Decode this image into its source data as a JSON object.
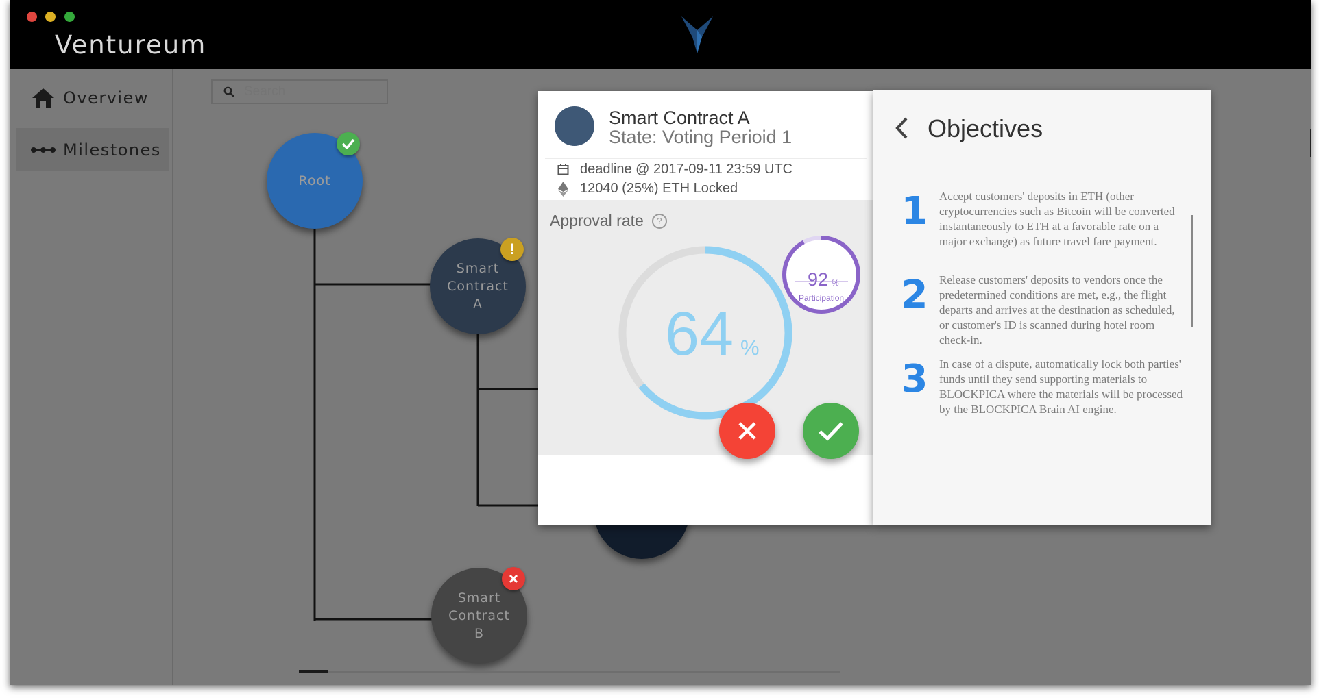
{
  "app": {
    "title": "Ventureum"
  },
  "sidebar": {
    "items": [
      {
        "label": "Overview",
        "icon": "home-icon"
      },
      {
        "label": "Milestones",
        "icon": "milestones-icon"
      }
    ]
  },
  "search": {
    "placeholder": "Search"
  },
  "tree": {
    "nodes": [
      {
        "label": "Root",
        "status": "approved"
      },
      {
        "label": "Smart Contract A",
        "status": "warning"
      },
      {
        "label": "Smart Contract B",
        "status": "rejected"
      }
    ]
  },
  "card": {
    "title": "Smart Contract A",
    "state": "State: Voting Perioid 1",
    "deadline": "deadline @ 2017-09-11 23:59 UTC",
    "locked": "12040 (25%) ETH Locked",
    "approval_label": "Approval rate",
    "approval_value": "64",
    "approval_unit": "%",
    "approval_fraction": 0.64,
    "participation_value": "92",
    "participation_unit": "%",
    "participation_label": "Participation",
    "participation_fraction": 0.92
  },
  "objectives": {
    "title": "Objectives",
    "items": [
      {
        "number": "1",
        "text": "Accept customers' deposits in ETH (other cryptocurrencies such as Bitcoin will be converted instantaneously to ETH at a favorable rate on a major exchange) as future travel fare payment."
      },
      {
        "number": "2",
        "text": "Release customers' deposits to vendors once the predetermined conditions are met, e.g., the flight departs and arrives at the destination as scheduled, or customer's ID is scanned during hotel room check-in."
      },
      {
        "number": "3",
        "text": "In case of a dispute, automatically lock both parties' funds until they send supporting materials to BLOCKPICA where the materials will be processed by the BLOCKPICA Brain AI engine."
      }
    ]
  },
  "colors": {
    "titlebar": "#000000",
    "background": "#7a7a7a",
    "root_node": "#2a69b0",
    "contract_a_node": "#2c3a4c",
    "contract_b_node": "#454545",
    "approve": "#4caf50",
    "reject": "#f44336",
    "approval_ring": "#8fd0f2",
    "participation_ring": "#8a64c8",
    "objective_number": "#2c86e4"
  }
}
